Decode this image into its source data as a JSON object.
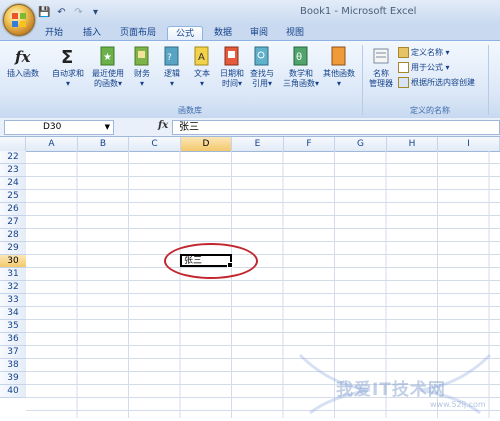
{
  "window": {
    "title": "Book1 - Microsoft Excel"
  },
  "tabs": [
    {
      "label": "开始"
    },
    {
      "label": "插入"
    },
    {
      "label": "页面布局"
    },
    {
      "label": "公式"
    },
    {
      "label": "数据"
    },
    {
      "label": "审阅"
    },
    {
      "label": "视图"
    }
  ],
  "ribbon": {
    "insert_function": "插入函数",
    "autosum": "自动求和",
    "recent_line1": "最近使用",
    "recent_line2": "的函数",
    "financial": "财务",
    "logical": "逻辑",
    "text": "文本",
    "datetime_line1": "日期和",
    "datetime_line2": "时间",
    "lookup_line1": "查找与",
    "lookup_line2": "引用",
    "math_line1": "数学和",
    "math_line2": "三角函数",
    "more": "其他函数",
    "name_mgr_line1": "名称",
    "name_mgr_line2": "管理器",
    "define_name": "定义名称",
    "use_in_formula": "用于公式",
    "create_from_selection": "根据所选内容创建",
    "group_function_library": "函数库",
    "group_defined_names": "定义的名称"
  },
  "formula_bar": {
    "name_box": "D30",
    "fx": "fx",
    "content": "张三"
  },
  "columns": [
    "A",
    "B",
    "C",
    "D",
    "E",
    "F",
    "G",
    "H",
    "I"
  ],
  "rows": [
    "22",
    "23",
    "24",
    "25",
    "26",
    "27",
    "28",
    "29",
    "30",
    "31",
    "32",
    "33",
    "34",
    "35",
    "36",
    "37",
    "38",
    "39",
    "40"
  ],
  "active_cell": {
    "value": "张三"
  },
  "watermark": {
    "text": "我爱IT技术网",
    "url": "www.52ij.com"
  }
}
